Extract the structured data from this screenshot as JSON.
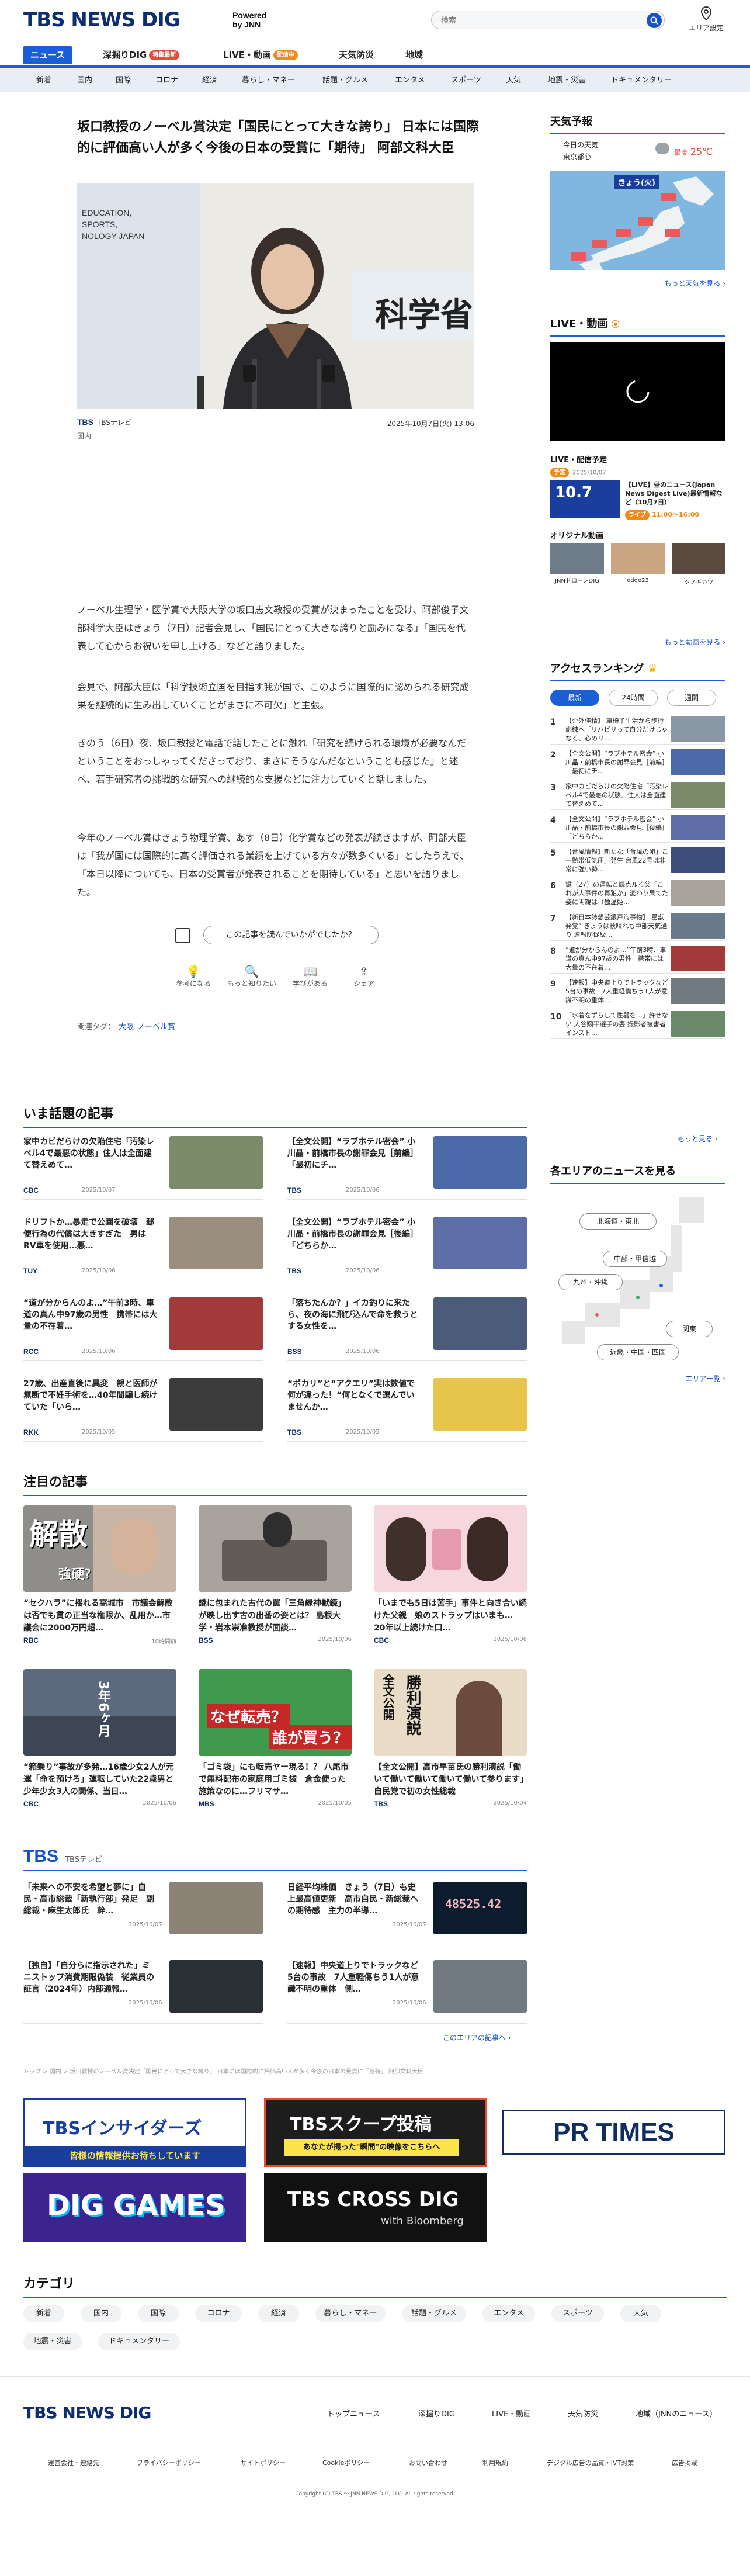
{
  "header": {
    "logo_main": "TBS NEWS DIG",
    "logo_powered_1": "Powered",
    "logo_powered_2": "by JNN",
    "search_placeholder": "検索",
    "area_label": "エリア設定"
  },
  "nav": {
    "items": [
      "ニュース",
      "深掘りDIG",
      "LIVE・動画",
      "天気防災",
      "地域"
    ],
    "badge_dig": "特集最新",
    "badge_live": "配信中",
    "categories": [
      "新着",
      "国内",
      "国際",
      "コロナ",
      "経済",
      "暮らし・マネー",
      "話題・グルメ",
      "エンタメ",
      "スポーツ",
      "天気",
      "地震・災害",
      "ドキュメンタリー"
    ]
  },
  "article": {
    "title": "坂口教授のノーベル賞決定「国民にとって大きな誇り」 日本には国際的に評価高い人が多く今後の日本の受賞に「期待」 阿部文科大臣",
    "photo_text": [
      "EDUCATION,",
      "SPORTS,",
      "NOLOGY-JAPAN",
      "科学省"
    ],
    "source": "TBSテレビ",
    "date": "2025年10月7日(火) 13:06",
    "category": "国内",
    "paragraphs": [
      "ノーベル生理学・医学賞で大阪大学の坂口志文教授の受賞が決まったことを受け、阿部俊子文部科学大臣はきょう（7日）記者会見し、「国民にとって大きな誇りと励みになる」「国民を代表して心からお祝いを申し上げる」などと語りました。",
      "会見で、阿部大臣は「科学技術立国を目指す我が国で、このように国際的に認められる研究成果を継続的に生み出していくことがまさに不可欠」と主張。",
      "きのう（6日）夜、坂口教授と電話で話したことに触れ「研究を続けられる環境が必要なんだということをおっしゃってくださっており、まさにそうなんだなということも感じた」と述べ、若手研究者の挑戦的な研究への継続的な支援などに注力していくと話しました。",
      "今年のノーベル賞はきょう物理学賞、あす（8日）化学賞などの発表が続きますが、阿部大臣は「我が国には国際的に高く評価される業績を上げている方々が数多くいる」としたうえで、「本日以降についても、日本の受賞者が発表されることを期待している」と思いを語りました。"
    ],
    "feedback": "この記事を読んでいかがでしたか？",
    "reactions": [
      "参考になる",
      "もっと知りたい",
      "学びがある",
      "シェア"
    ],
    "tags_label": "関連タグ：",
    "tags": [
      "大阪",
      "ノーベル賞"
    ]
  },
  "hot": {
    "title": "いま話題の記事",
    "items": [
      {
        "text": "家中カビだらけの欠陥住宅「汚染レベル4で最悪の状態」住人は全面建て替えめて…",
        "src": "CBC",
        "date": "2025/10/07"
      },
      {
        "text": "【全文公開】“ラブホテル密会” 小川晶・前橋市長の謝罪会見［前編］「最初にチ…",
        "src": "TBS",
        "date": "2025/10/06"
      },
      {
        "text": "ドリフトか…暴走で公園を破壊　郵便行為の代償は大きすぎた　男はRV車を使用…悪…",
        "src": "TUY",
        "date": "2025/10/06"
      },
      {
        "text": "【全文公開】“ラブホテル密会” 小川晶・前橋市長の謝罪会見［後編］「どちらか…",
        "src": "TBS",
        "date": "2025/10/06"
      },
      {
        "text": "“道が分からんのよ…”午前3時、車道の真ん中97歳の男性　携帯には大量の不在着…",
        "src": "RCC",
        "date": "2025/10/06"
      },
      {
        "text": "「落ちたんか？」イカ釣りに来たら、夜の海に飛び込んで命を救うとする女性を…",
        "src": "BSS",
        "date": "2025/10/06"
      },
      {
        "text": "27歳、出産直後に異変　親と医師が無断で不妊手術を…40年間騙し続けていた「いら…",
        "src": "RKK",
        "date": "2025/10/05"
      },
      {
        "text": "“ポカリ”と“アクエリ”実は数値で何が違った！“何となくで選んでいませんか…",
        "src": "TBS",
        "date": "2025/10/05"
      }
    ]
  },
  "featured": {
    "title": "注目の記事",
    "items": [
      {
        "text": "“セクハラ”に揺れる高城市　市議会解散は否でも貫の正当な権限か、乱用か…市議会に2000万円超…",
        "src": "RBC",
        "date": "10時間前"
      },
      {
        "text": "謎に包まれた古代の罠「三角縁神獣鏡」が映し出す古の出番の姿とは？ 島根大学・岩本崇准教授が面談…",
        "src": "BSS",
        "date": "2025/10/06"
      },
      {
        "text": "「いまでも5日は苦手」事件と向き合い続けた父親　娘のストラップはいまも…　20年以上続けた口…",
        "src": "CBC",
        "date": "2025/10/06"
      },
      {
        "text": "“箱乗り”事故が多発…16歳少女2人が元運「命を預けろ」運転していた22歳男と少年少女3人の関係、当日…",
        "src": "CBC",
        "date": "2025/10/06"
      },
      {
        "text": "「ゴミ袋」にも転売ヤー現る！？ 八尾市で無料配布の家庭用ゴミ袋　倉金使った施策なのに…フリマサ…",
        "src": "MBS",
        "date": "2025/10/05"
      },
      {
        "text": "【全文公開】高市早苗氏の勝利演説「働いて働いて働いて働いて働いて参ります」自民党で初の女性総裁",
        "src": "TBS",
        "date": "2025/10/04"
      }
    ],
    "img1_text": "解散",
    "img1_sub": "強硬？",
    "img4_text": "3年6ヶ月",
    "img5_text": "なぜ転売？",
    "img5_text2": "誰が買う？",
    "img6_text": "全文公開",
    "img6_text2": "勝利演説"
  },
  "tbs": {
    "logo": "TBS",
    "sub": "TBSテレビ",
    "items": [
      {
        "text": "「未来への不安を希望と夢に」自民・高市総裁「新執行部」発足　副総裁・麻生太郎氏　幹…",
        "date": "2025/10/07"
      },
      {
        "text": "日経平均株価　きょう（7日）も史上最高値更新　高市自民・新総裁への期待感　主力の半導…",
        "date": "2025/10/07"
      },
      {
        "text": "【独自】「自分らに指示された」ミニストップ消費期限偽装　従業員の証言（2024年）内部通報…",
        "date": "2025/10/06"
      },
      {
        "text": "【速報】中央道上りでトラックなど5台の事故　7人重軽傷ちう1人が意識不明の重体　側…",
        "date": "2025/10/06"
      }
    ],
    "stock": "48525.42",
    "more": "このエリアの記事へ ›"
  },
  "breadcrumb": "トップ > 国内 > 坂口教授のノーベル賞決定「国民にとって大きな誇り」 日本には国際的に評価高い人が多く今後の日本の受賞に「期待」 阿部文科大臣",
  "banners": {
    "insiders": "TBSインサイダーズ",
    "insiders_sub": "皆様の情報提供お待ちしています",
    "scoop": "TBSスクープ投稿",
    "scoop_sub": "あなたが撮った\"瞬間\"の映像をこちらへ",
    "prtimes": "PR TIMES",
    "diggames": "DIG GAMES",
    "crossdig": "TBS CROSS DIG",
    "crossdig_sub": "with Bloomberg"
  },
  "category": {
    "title": "カテゴリ",
    "items": [
      "新着",
      "国内",
      "国際",
      "コロナ",
      "経済",
      "暮らし・マネー",
      "話題・グルメ",
      "エンタメ",
      "スポーツ",
      "天気",
      "地震・災害",
      "ドキュメンタリー"
    ]
  },
  "sidebar": {
    "weather_title": "天気予報",
    "weather_today": "今日の天気",
    "weather_region": "東京都心",
    "weather_max_label": "最高",
    "weather_max": "25℃",
    "weather_map_label": "きょう(火)",
    "weather_more": "もっと天気を見る ›",
    "live_title": "LIVE・動画",
    "live_schedule": "LIVE・配信予定",
    "live_tag": "予定",
    "live_date": "2025/10/07",
    "live_date2": "10.7",
    "live_item": "【LIVE】昼のニュース(Japan News Digest Live)最新情報など（10月7日）",
    "live_live_badge": "ライブ",
    "live_time": "11:00～16:00",
    "original_title": "オリジナル動画",
    "original_items": [
      "JNNドローンDIG",
      "edge23",
      "シノギカツ"
    ],
    "live_more": "もっと動画を見る ›",
    "ranking_title": "アクセスランキング",
    "ranking_tabs": [
      "最新",
      "24時間",
      "週間"
    ],
    "ranking": [
      "【歪外佳精】 車椅子生活から歩行訓練へ「リハビリって自分だけじゃなく、心のリ…",
      "【全文公開】“ラブホテル密会” 小川晶・前橋市長の謝罪会見［前編］「最初にチ…",
      "家中カビだらけの欠陥住宅「汚染レベル4で最悪の状態」住人は全面建て替えめて…",
      "【全文公開】“ラブホテル密会” 小川晶・前橋市長の謝罪会見［後編］「どちらか…",
      "【台風情報】新たな「台風の卵」こ一熱帯低気圧」発生 台風22号は非常に強い勢…",
      "鍵（27）の運転と読点ルろ父「これが大事件の再犯か」変わり果てた姿に両親は（独温姫…",
      "【新日本誌想芸銀戸海事物】 昆獣発覚” きょうは秋晴れも中部天気通り 連報防促級…",
      "“道が分からんのよ…”午前3時、車道の真ん中97歳の男性　携帯には大量の不在着…",
      "【速報】中央道上りでトラックなど5台の事故　7人重軽傷ちう1人が意識不明の重体…",
      "「水着をずらして性器を…」許せない 大谷翔平選手の妻 撮影者被害者　インスト…"
    ],
    "ranking_more": "もっと見る ›",
    "region_title": "各エリアのニュースを見る",
    "regions": [
      "北海道・東北",
      "中部・甲信越",
      "九州・沖縄",
      "関東",
      "近畿・中国・四国"
    ],
    "region_more": "エリア一覧 ›"
  },
  "footer": {
    "logo": "TBS NEWS DIG",
    "nav": [
      "トップニュース",
      "深掘りDIG",
      "LIVE・動画",
      "天気防災",
      "地域（JNNのニュース）"
    ],
    "links": [
      "運営会社・連絡先",
      "プライバシーポリシー",
      "サイトポリシー",
      "Cookieポリシー",
      "お問い合わせ",
      "利用規約",
      "デジタル広告の品質・IVT対策",
      "広告掲載"
    ],
    "copyright": "Copyright (C) TBS ～ JNN NEWS DIG, LLC. All rights reserved."
  },
  "colors": {
    "brand": "#0e2e6e",
    "accent": "#1a5fd8",
    "badge_orange": "#f08a1a",
    "badge_red": "#e34d3c"
  }
}
